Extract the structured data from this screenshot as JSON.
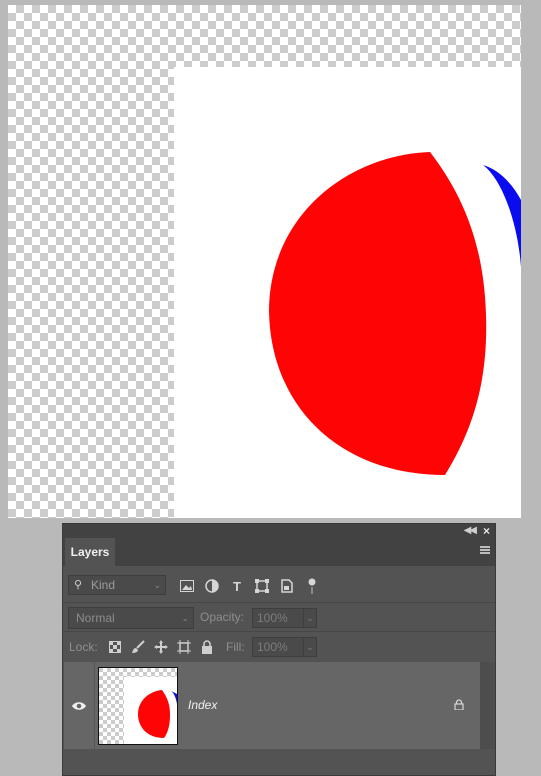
{
  "document": {
    "shape_colors": {
      "red": "#ff0404",
      "blue": "#0b0bf0",
      "white": "#ffffff"
    }
  },
  "layers_panel": {
    "tab_label": "Layers",
    "kind_filter": {
      "value": "Kind",
      "icon": "search-icon"
    },
    "filter_icons": [
      "image-filter-icon",
      "adjustment-filter-icon",
      "type-filter-icon",
      "shape-filter-icon",
      "smart-object-filter-icon",
      "filter-toggle-icon"
    ],
    "blend_mode": "Normal",
    "opacity_label": "Opacity:",
    "opacity_value": "100%",
    "lock_label": "Lock:",
    "lock_icons": [
      "lock-transparent-pixels-icon",
      "lock-image-pixels-icon",
      "lock-position-icon",
      "lock-artboard-icon",
      "lock-all-icon"
    ],
    "fill_label": "Fill:",
    "fill_value": "100%",
    "layers": [
      {
        "name": "Index",
        "visible": true,
        "locked": true
      }
    ]
  }
}
